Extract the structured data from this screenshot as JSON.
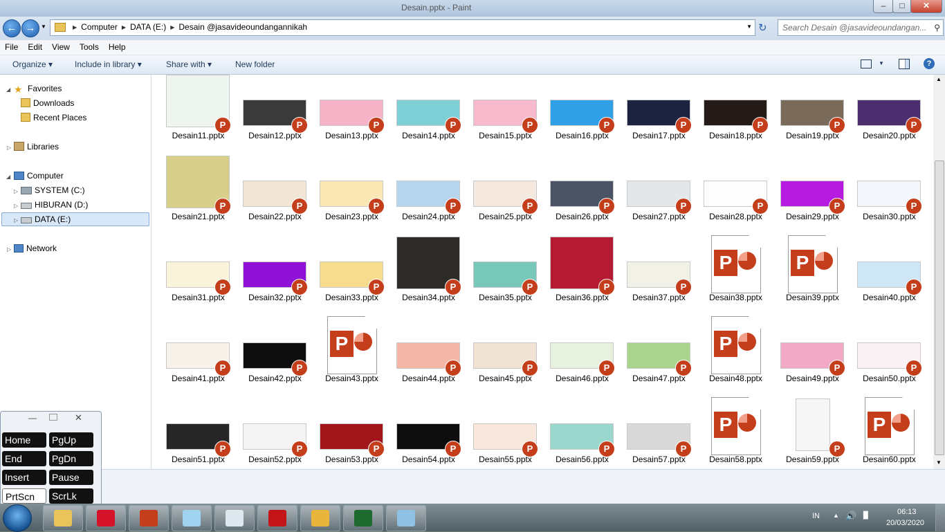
{
  "window": {
    "title": "Desain.pptx - Paint",
    "controls": {
      "minimize": "–",
      "maximize": "□",
      "close": "✕"
    }
  },
  "address": {
    "crumbs": [
      "Computer",
      "DATA (E:)",
      "Desain @jasavideoundangannikah"
    ],
    "search_placeholder": "Search Desain @jasavideoundangan..."
  },
  "menu": [
    "File",
    "Edit",
    "View",
    "Tools",
    "Help"
  ],
  "toolbar": {
    "organize": "Organize ▾",
    "include": "Include in library ▾",
    "share": "Share with ▾",
    "new_folder": "New folder"
  },
  "sidebar": {
    "favorites": "Favorites",
    "downloads": "Downloads",
    "recent": "Recent Places",
    "libraries": "Libraries",
    "computer": "Computer",
    "system": "SYSTEM (C:)",
    "hiburan": "HIBURAN (D:)",
    "data": "DATA (E:)",
    "network": "Network"
  },
  "files": [
    {
      "name": "Desain11.pptx",
      "thumb": "#eef6ef"
    },
    {
      "name": "Desain12.pptx",
      "thumb": "#3a3a3a"
    },
    {
      "name": "Desain13.pptx",
      "thumb": "#f6b3c8"
    },
    {
      "name": "Desain14.pptx",
      "thumb": "#7fd0d6"
    },
    {
      "name": "Desain15.pptx",
      "thumb": "#f7b9cc"
    },
    {
      "name": "Desain16.pptx",
      "thumb": "#2f9fe6"
    },
    {
      "name": "Desain17.pptx",
      "thumb": "#1b2340"
    },
    {
      "name": "Desain18.pptx",
      "thumb": "#241b18"
    },
    {
      "name": "Desain19.pptx",
      "thumb": "#7a6a5a"
    },
    {
      "name": "Desain20.pptx",
      "thumb": "#4b2f6e"
    },
    {
      "name": "Desain21.pptx",
      "thumb": "#d8d08a"
    },
    {
      "name": "Desain22.pptx",
      "thumb": "#f2e6d7"
    },
    {
      "name": "Desain23.pptx",
      "thumb": "#fbe8b4"
    },
    {
      "name": "Desain24.pptx",
      "thumb": "#b7d4ef"
    },
    {
      "name": "Desain25.pptx",
      "thumb": "#f5e9df"
    },
    {
      "name": "Desain26.pptx",
      "thumb": "#4b5464"
    },
    {
      "name": "Desain27.pptx",
      "thumb": "#e4e7ea"
    },
    {
      "name": "Desain28.pptx",
      "thumb": "#fdfdfd"
    },
    {
      "name": "Desain29.pptx",
      "thumb": "#b71be0"
    },
    {
      "name": "Desain30.pptx",
      "thumb": "#f3f7fb"
    },
    {
      "name": "Desain31.pptx",
      "thumb": "#fbf4dc"
    },
    {
      "name": "Desain32.pptx",
      "thumb": "#8f12d6"
    },
    {
      "name": "Desain33.pptx",
      "thumb": "#f7dc8e"
    },
    {
      "name": "Desain34.pptx",
      "thumb": "#2c2b28"
    },
    {
      "name": "Desain35.pptx",
      "thumb": "#77c8b8"
    },
    {
      "name": "Desain36.pptx",
      "thumb": "#b51b32"
    },
    {
      "name": "Desain37.pptx",
      "thumb": "#f1f1e8"
    },
    {
      "name": "Desain38.pptx",
      "thumb": "doc"
    },
    {
      "name": "Desain39.pptx",
      "thumb": "doc"
    },
    {
      "name": "Desain40.pptx",
      "thumb": "#cfe6f6"
    },
    {
      "name": "Desain41.pptx",
      "thumb": "#f7f3ea"
    },
    {
      "name": "Desain42.pptx",
      "thumb": "#0d0d0d"
    },
    {
      "name": "Desain43.pptx",
      "thumb": "doc"
    },
    {
      "name": "Desain44.pptx",
      "thumb": "#f4b6a6"
    },
    {
      "name": "Desain45.pptx",
      "thumb": "#f1e3d3"
    },
    {
      "name": "Desain46.pptx",
      "thumb": "#e8f0e0"
    },
    {
      "name": "Desain47.pptx",
      "thumb": "#a9d48d"
    },
    {
      "name": "Desain48.pptx",
      "thumb": "doc"
    },
    {
      "name": "Desain49.pptx",
      "thumb": "#f2a9c6"
    },
    {
      "name": "Desain50.pptx",
      "thumb": "#fbf2f6"
    },
    {
      "name": "Desain51.pptx",
      "thumb": "#262626"
    },
    {
      "name": "Desain52.pptx",
      "thumb": "#f4f4f4"
    },
    {
      "name": "Desain53.pptx",
      "thumb": "#a2151b"
    },
    {
      "name": "Desain54.pptx",
      "thumb": "#0d0d0d"
    },
    {
      "name": "Desain55.pptx",
      "thumb": "#f8e7dc"
    },
    {
      "name": "Desain56.pptx",
      "thumb": "#9ad7cd"
    },
    {
      "name": "Desain57.pptx",
      "thumb": "#d9d9d9"
    },
    {
      "name": "Desain58.pptx",
      "thumb": "doc"
    },
    {
      "name": "Desain59.pptx",
      "thumb": "#f6f6f6"
    },
    {
      "name": "Desain60.pptx",
      "thumb": "doc"
    }
  ],
  "osk_keys": [
    "Home",
    "PgUp",
    "End",
    "PgDn",
    "Insert",
    "Pause",
    "PrtScn",
    "ScrLk"
  ],
  "tray": {
    "lang": "IN",
    "time": "06:13",
    "date": "20/03/2020"
  },
  "taskbar_apps": [
    {
      "name": "explorer-app",
      "color": "#e8c45a"
    },
    {
      "name": "opera-app",
      "color": "#d4122a"
    },
    {
      "name": "powerpoint-app",
      "color": "#c43e1c"
    },
    {
      "name": "notepad-app",
      "color": "#9fd3f0"
    },
    {
      "name": "keyboard-app",
      "color": "#dfe7ef"
    },
    {
      "name": "acrobat-app",
      "color": "#c3141a"
    },
    {
      "name": "chrome-app",
      "color": "#e9b53b"
    },
    {
      "name": "terminal-app",
      "color": "#1f6a2e"
    },
    {
      "name": "paint-app",
      "color": "#8fc1e4"
    }
  ]
}
